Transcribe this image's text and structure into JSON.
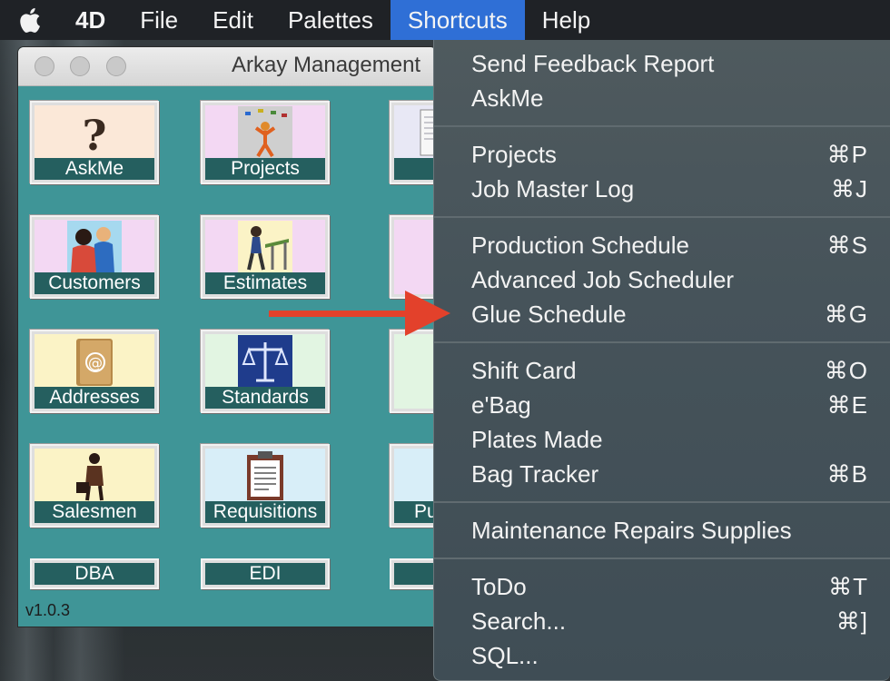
{
  "menubar": {
    "app_name": "4D",
    "items": [
      "File",
      "Edit",
      "Palettes",
      "Shortcuts",
      "Help"
    ],
    "active": "Shortcuts"
  },
  "window": {
    "title": "Arkay Management",
    "version": "v1.0.3",
    "tiles": [
      {
        "label": "AskMe"
      },
      {
        "label": "Projects"
      },
      {
        "label": "Jo"
      },
      {
        "label": "Customers"
      },
      {
        "label": "Estimates"
      },
      {
        "label": "Addresses"
      },
      {
        "label": "Standards"
      },
      {
        "label": "Salesmen"
      },
      {
        "label": "Requisitions"
      },
      {
        "label": "Pu"
      }
    ],
    "small_tiles": [
      {
        "label": "DBA"
      },
      {
        "label": "EDI"
      }
    ]
  },
  "shortcuts_menu": {
    "items": [
      {
        "label": "Send Feedback Report",
        "shortcut": ""
      },
      {
        "label": "AskMe",
        "shortcut": ""
      },
      {
        "label": "Projects",
        "shortcut": "⌘P"
      },
      {
        "label": "Job Master Log",
        "shortcut": "⌘J"
      },
      {
        "label": "Production Schedule",
        "shortcut": "⌘S"
      },
      {
        "label": "Advanced Job Scheduler",
        "shortcut": ""
      },
      {
        "label": "Glue Schedule",
        "shortcut": "⌘G"
      },
      {
        "label": "Shift Card",
        "shortcut": "⌘O"
      },
      {
        "label": "e'Bag",
        "shortcut": "⌘E"
      },
      {
        "label": "Plates Made",
        "shortcut": ""
      },
      {
        "label": "Bag Tracker",
        "shortcut": "⌘B"
      },
      {
        "label": "Maintenance Repairs Supplies",
        "shortcut": ""
      },
      {
        "label": "ToDo",
        "shortcut": "⌘T"
      },
      {
        "label": "Search...",
        "shortcut": "⌘]"
      },
      {
        "label": "SQL...",
        "shortcut": ""
      }
    ]
  },
  "icons": {
    "apple": "apple-logo-icon",
    "arrow": "red-arrow-icon"
  },
  "colors": {
    "menu_highlight": "#2f6fd6",
    "window_bg": "#3f9597",
    "tile_label_bg": "#255f5f",
    "arrow": "#e3412b"
  }
}
